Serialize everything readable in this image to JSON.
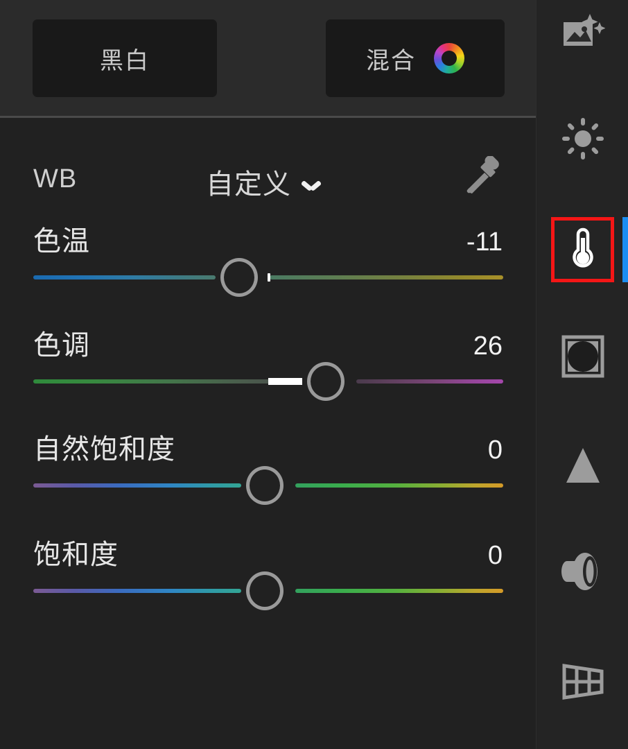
{
  "app": {
    "theme_bg": "#212121",
    "panel_bg": "#2b2b2b",
    "accent": "#1b8ef2",
    "highlight": "#f41616"
  },
  "mode_bar": {
    "buttons": [
      {
        "label": "黑白",
        "name": "bw-button",
        "has_wheel": false
      },
      {
        "label": "混合",
        "name": "mix-button",
        "has_wheel": true,
        "icon": "color-wheel-icon"
      }
    ]
  },
  "wb": {
    "label": "WB",
    "preset": "自定义",
    "chevron": "chevron-down-icon",
    "eyedropper": "eyedropper-icon"
  },
  "sliders": [
    {
      "name": "色温",
      "value": "-11",
      "key": "temperature",
      "knob_pct": 44.5,
      "zero_pct": 49.8,
      "left_label": "blue",
      "right_label": "yellow"
    },
    {
      "name": "色调",
      "value": "26",
      "key": "tint",
      "knob_pct": 63.0,
      "zero_pct": 50.0,
      "left_label": "green",
      "right_label": "magenta"
    },
    {
      "name": "自然饱和度",
      "value": "0",
      "key": "vibrance",
      "knob_pct": 50.0,
      "zero_pct": 50.0,
      "left_label": "desaturated",
      "right_label": "saturated"
    },
    {
      "name": "饱和度",
      "value": "0",
      "key": "saturation",
      "knob_pct": 50.0,
      "zero_pct": 50.0,
      "left_label": "desaturated",
      "right_label": "saturated"
    }
  ],
  "toolbar": {
    "items": [
      {
        "icon": "auto-enhance-icon",
        "name": "tool-auto",
        "selected": false
      },
      {
        "icon": "light-sun-icon",
        "name": "tool-light",
        "selected": false
      },
      {
        "icon": "thermometer-color-icon",
        "name": "tool-color",
        "selected": true
      },
      {
        "icon": "vignette-effects-icon",
        "name": "tool-effects",
        "selected": false
      },
      {
        "icon": "triangle-detail-icon",
        "name": "tool-detail",
        "selected": false
      },
      {
        "icon": "lens-optics-icon",
        "name": "tool-optics",
        "selected": false
      },
      {
        "icon": "geometry-grid-icon",
        "name": "tool-geometry",
        "selected": false
      }
    ]
  }
}
